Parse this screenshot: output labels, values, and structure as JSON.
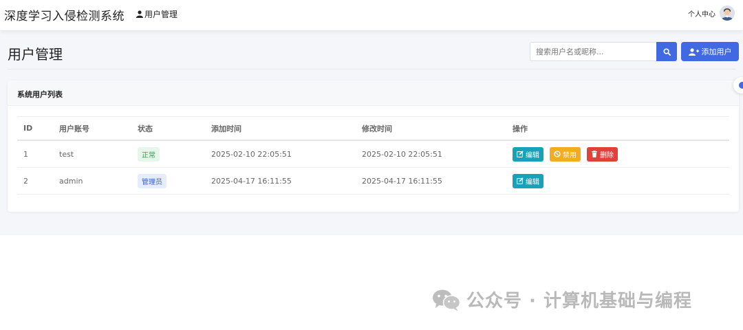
{
  "navbar": {
    "brand": "深度学习入侵检测系统",
    "nav_link": "用户管理",
    "user_center": "个人中心"
  },
  "page": {
    "title": "用户管理",
    "search_placeholder": "搜索用户名或昵称...",
    "add_button": "添加用户"
  },
  "card": {
    "title": "系统用户列表"
  },
  "table": {
    "headers": [
      "ID",
      "用户账号",
      "状态",
      "添加时间",
      "修改时间",
      "操作"
    ],
    "rows": [
      {
        "id": "1",
        "account": "test",
        "status": "正常",
        "added": "2025-02-10 22:05:51",
        "modified": "2025-02-10 22:05:51",
        "actions": [
          "编辑",
          "禁用",
          "删除"
        ]
      },
      {
        "id": "2",
        "account": "admin",
        "status": "管理员",
        "added": "2025-04-17 16:11:55",
        "modified": "2025-04-17 16:11:55",
        "actions": [
          "编辑"
        ]
      }
    ]
  },
  "watermark": "公众号 · 计算机基础与编程",
  "colors": {
    "primary": "#4169e1",
    "edit": "#17a2b8",
    "disable": "#f0ad1e",
    "delete": "#e0413a",
    "status_normal": "#2e9e4f",
    "status_admin": "#3b5fc9"
  }
}
